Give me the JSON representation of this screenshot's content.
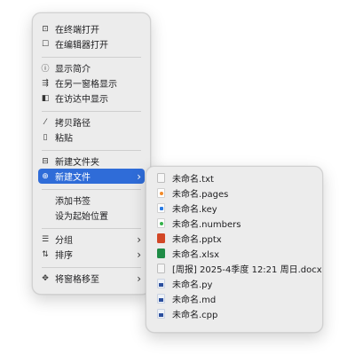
{
  "main_menu": {
    "open_in_terminal": {
      "icon": "terminal-icon",
      "label": "在终端打开"
    },
    "open_in_editor": {
      "icon": "edit-icon",
      "label": "在编辑器打开"
    },
    "get_info": {
      "icon": "info-icon",
      "label": "显示简介"
    },
    "show_in_other_pane": {
      "icon": "split-pane-icon",
      "label": "在另一窗格显示"
    },
    "show_in_finder": {
      "icon": "finder-icon",
      "label": "在访达中显示"
    },
    "copy_path": {
      "icon": "path-icon",
      "label": "拷贝路径"
    },
    "paste": {
      "icon": "clipboard-icon",
      "label": "粘贴"
    },
    "new_folder": {
      "icon": "new-folder-icon",
      "label": "新建文件夹"
    },
    "new_file": {
      "icon": "new-file-icon",
      "label": "新建文件"
    },
    "add_bookmark": {
      "label": "添加书签"
    },
    "set_start": {
      "label": "设为起始位置"
    },
    "group": {
      "icon": "group-icon",
      "label": "分组"
    },
    "sort": {
      "icon": "sort-icon",
      "label": "排序"
    },
    "move_pane": {
      "icon": "move-icon",
      "label": "将窗格移至"
    }
  },
  "sub_menu": {
    "items": [
      {
        "type": "txt",
        "label": "未命名.txt"
      },
      {
        "type": "pages",
        "label": "未命名.pages"
      },
      {
        "type": "key",
        "label": "未命名.key"
      },
      {
        "type": "numbers",
        "label": "未命名.numbers"
      },
      {
        "type": "pptx",
        "label": "未命名.pptx"
      },
      {
        "type": "xlsx",
        "label": "未命名.xlsx"
      },
      {
        "type": "docx",
        "label": "[周报] 2025-4季度 12:21 周日.docx"
      },
      {
        "type": "py",
        "label": "未命名.py"
      },
      {
        "type": "md",
        "label": "未命名.md"
      },
      {
        "type": "cpp",
        "label": "未命名.cpp"
      }
    ]
  },
  "glyphs": {
    "terminal": "⊡",
    "edit": "☐",
    "info": "ⓘ",
    "split": "⇶",
    "finder": "◧",
    "path": "⁄",
    "paste": "▯",
    "folder": "⊟",
    "file": "⊕",
    "group": "☰",
    "sort": "⇅",
    "move": "✥",
    "chevron": "›"
  },
  "colors": {
    "accent": "#2f6cd8",
    "menu_bg": "#ececec"
  }
}
